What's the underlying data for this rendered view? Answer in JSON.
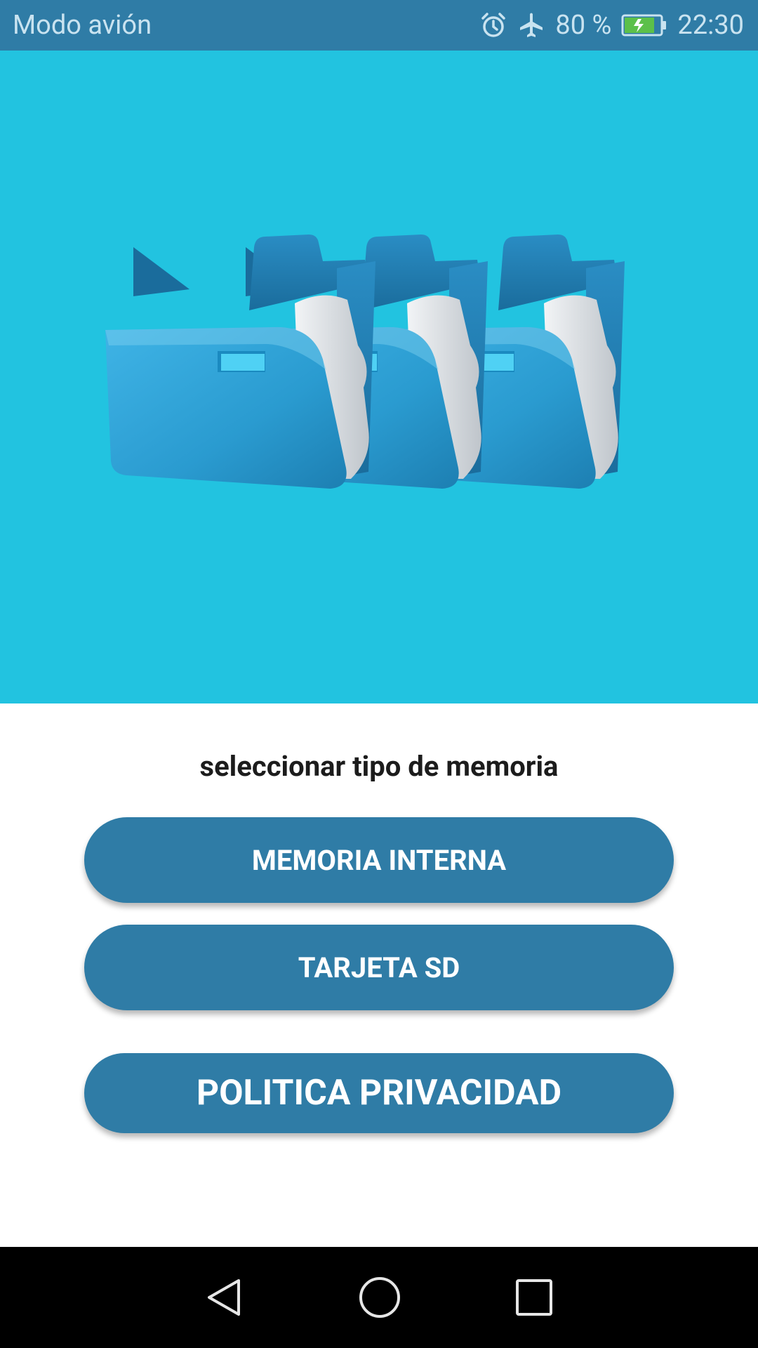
{
  "status_bar": {
    "mode_text": "Modo avión",
    "battery_percent": "80 %",
    "time": "22:30",
    "icons": [
      "alarm-icon",
      "airplane-icon",
      "battery-charging-icon"
    ],
    "battery_level": 0.8
  },
  "hero": {
    "image": "three-blue-folders",
    "background_color": "#22c3e0"
  },
  "main": {
    "prompt": "seleccionar tipo de memoria",
    "buttons": {
      "internal_memory": "MEMORIA INTERNA",
      "sd_card": "TARJETA SD",
      "privacy_policy": "POLITICA PRIVACIDAD"
    },
    "button_color": "#2f7ca6"
  },
  "nav_bar": {
    "icons": [
      "back-icon",
      "home-icon",
      "recents-icon"
    ]
  }
}
